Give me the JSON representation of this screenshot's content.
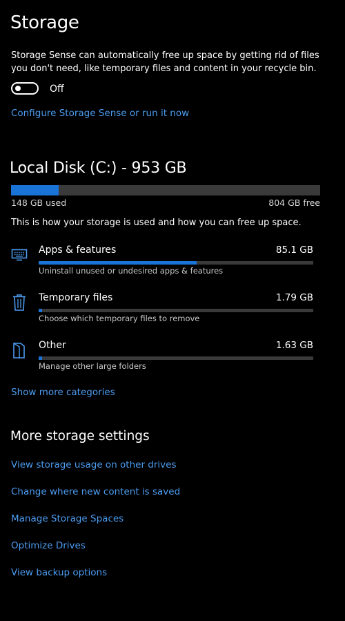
{
  "page": {
    "title": "Storage"
  },
  "storage_sense": {
    "description": "Storage Sense can automatically free up space by getting rid of files you don't need, like temporary files and content in your recycle bin.",
    "toggle_state": "Off",
    "configure_link": "Configure Storage Sense or run it now"
  },
  "disk": {
    "title": "Local Disk (C:) - 953 GB",
    "used_label": "148 GB used",
    "free_label": "804 GB free",
    "used_fraction": 0.155,
    "note": "This is how your storage is used and how you can free up space."
  },
  "categories": [
    {
      "name": "Apps & features",
      "size": "85.1 GB",
      "description": "Uninstall unused or undesired apps & features",
      "usage_fraction": 0.575,
      "icon": "apps-features-icon"
    },
    {
      "name": "Temporary files",
      "size": "1.79 GB",
      "description": "Choose which temporary files to remove",
      "usage_fraction": 0.012,
      "icon": "trash-icon"
    },
    {
      "name": "Other",
      "size": "1.63 GB",
      "description": "Manage other large folders",
      "usage_fraction": 0.011,
      "icon": "other-folder-icon"
    }
  ],
  "show_more_link": "Show more categories",
  "more_settings": {
    "title": "More storage settings",
    "links": [
      "View storage usage on other drives",
      "Change where new content is saved",
      "Manage Storage Spaces",
      "Optimize Drives",
      "View backup options"
    ]
  },
  "colors": {
    "background": "#000000",
    "accent": "#1a73d6",
    "link": "#4c9cf0",
    "bar_track": "#3a3a3a"
  }
}
